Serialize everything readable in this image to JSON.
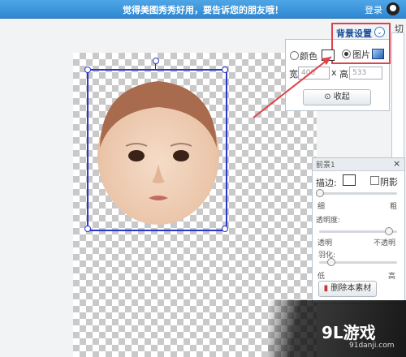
{
  "topbar": {
    "message": "觉得美图秀秀好用，要告诉您的朋友哦！",
    "login_label": "登录",
    "qq_icon": "qq-icon"
  },
  "right_edge": {
    "tab_label": "切"
  },
  "background_panel": {
    "title": "背景设置",
    "color_option": "颜色",
    "image_option": "图片",
    "selected_option": "图片",
    "width_label": "宽",
    "width_value": "400",
    "x_label": "x",
    "height_label": "高",
    "height_value": "533",
    "collapse_label": "收起"
  },
  "foreground_panel": {
    "title": "前景1",
    "close_label": "×",
    "border_label": "描边:",
    "shadow_label": "阴影",
    "thin_label": "细",
    "thick_label": "粗",
    "transparency_label": "透明度:",
    "transparent_label": "透明",
    "opaque_label": "不透明",
    "feather_label": "羽化:",
    "low_label": "低",
    "high_label": "高",
    "delete_label": "删除本素材"
  },
  "canvas": {
    "colors": {
      "selection": "#2a36c8",
      "highlight": "#e0424a"
    }
  },
  "watermark": {
    "brand": "9L游戏",
    "site": "91danji.com"
  }
}
